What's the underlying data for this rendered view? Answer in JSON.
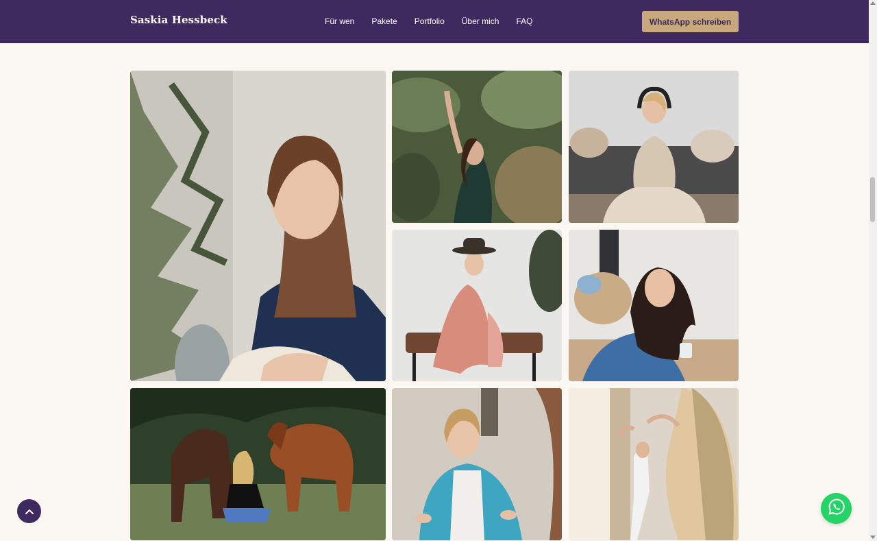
{
  "header": {
    "brand": "Saskia Hessbeck",
    "nav": [
      "Für wen",
      "Pakete",
      "Portfolio",
      "Über mich",
      "FAQ"
    ],
    "cta_label": "WhatsApp schreiben"
  },
  "colors": {
    "header_bg": "#3e2a5f",
    "cta_bg": "#c8a97e",
    "page_bg": "#fbf8f3",
    "whatsapp_green": "#25d366"
  },
  "gallery": {
    "photos": [
      "portrait-woman-navy-blouse",
      "woman-stretching-among-plants",
      "woman-meditating-headphones",
      "woman-hat-on-bench",
      "woman-smiling-with-mug",
      "woman-with-two-horses",
      "woman-turquoise-cardigan",
      "women-stretching-at-window"
    ]
  },
  "floating": {
    "back_to_top_icon": "chevron-up-icon",
    "whatsapp_icon": "whatsapp-icon"
  }
}
